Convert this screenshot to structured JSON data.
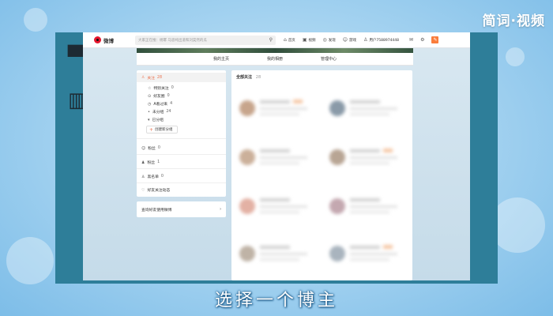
{
  "brand": "简词·视频",
  "caption": "选择一个博主",
  "logo": {
    "text": "微博",
    "icon": "weibo-eye-icon"
  },
  "search": {
    "placeholder": "大家正在搜：杨幂 马思纯出道和刘昊然的瓜"
  },
  "nav": {
    "items": [
      {
        "label": "首页",
        "icon": "home-icon"
      },
      {
        "label": "视频",
        "icon": "video-icon"
      },
      {
        "label": "发现",
        "icon": "compass-icon"
      },
      {
        "label": "游戏",
        "icon": "gamepad-icon"
      },
      {
        "label": "用户7588974448",
        "icon": "user-icon"
      }
    ]
  },
  "tabs": [
    "我的主页",
    "我的相册",
    "管理中心"
  ],
  "left_panel": {
    "header": {
      "label": "关注",
      "count": "28",
      "icon": "follow-icon"
    },
    "groups": [
      {
        "label": "特别关注",
        "count": "0"
      },
      {
        "label": "好友圈",
        "count": "0"
      },
      {
        "label": "A看过来",
        "count": "4"
      },
      {
        "label": "未分组",
        "count": "24"
      },
      {
        "label": "已分组",
        "count": ""
      }
    ],
    "new_group": "创建新分组",
    "sections": [
      {
        "label": "粉丝",
        "count": "0",
        "icon": "fans-icon"
      },
      {
        "label": "粉丝",
        "count": "1",
        "icon": "fans-icon"
      },
      {
        "label": "黑名单",
        "count": "0",
        "icon": "blacklist-icon"
      },
      {
        "label": "好友关注动态",
        "count": "",
        "icon": "activity-icon"
      }
    ]
  },
  "query_panel": {
    "label": "查询好友使用微博",
    "arrow": "›"
  },
  "right_panel": {
    "title": "全部关注",
    "count": "28"
  },
  "colors": {
    "accent": "#eb7350",
    "frame": "#2e7e99",
    "orange": "#fa7d3c"
  }
}
